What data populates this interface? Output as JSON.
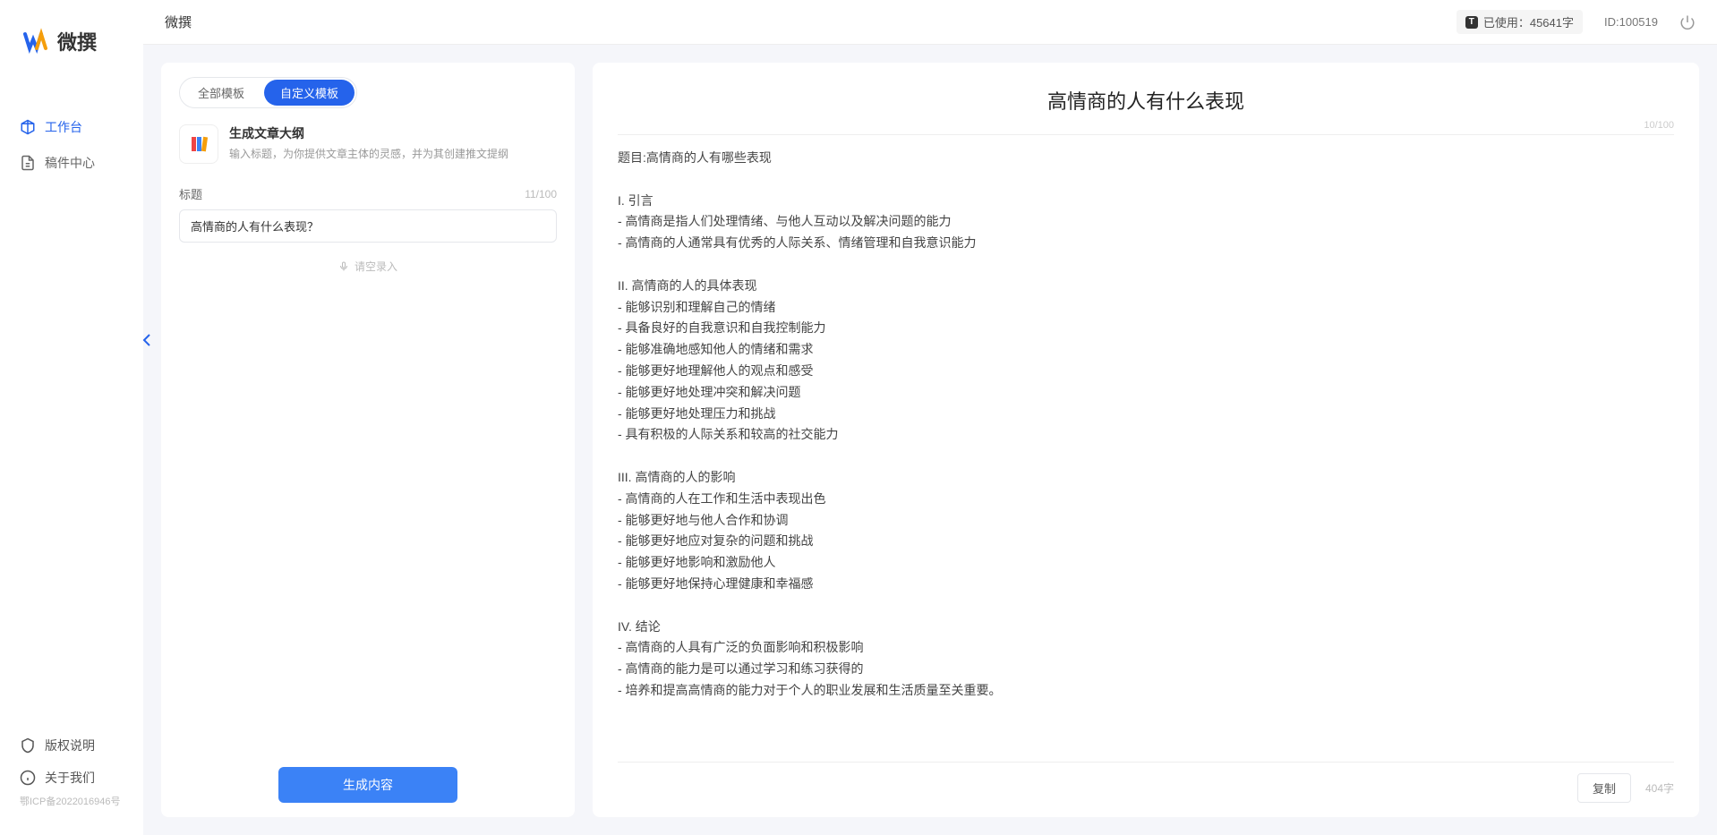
{
  "brand": {
    "name": "微撰"
  },
  "nav": {
    "workbench": "工作台",
    "drafts": "稿件中心"
  },
  "footer": {
    "copyright": "版权说明",
    "about": "关于我们",
    "icp": "鄂ICP备2022016946号"
  },
  "topbar": {
    "title": "微撰",
    "usage_label": "已使用：45641字",
    "user_id": "ID:100519"
  },
  "tabs": {
    "all": "全部模板",
    "custom": "自定义模板"
  },
  "template": {
    "title": "生成文章大纲",
    "desc": "输入标题，为你提供文章主体的灵感，并为其创建推文提纲"
  },
  "form": {
    "title_label": "标题",
    "title_count": "11/100",
    "title_value": "高情商的人有什么表现？",
    "voice_record": "请空录入",
    "generate": "生成内容"
  },
  "output": {
    "title": "高情商的人有什么表现",
    "title_count": "10/100",
    "body": "题目:高情商的人有哪些表现\n\nI. 引言\n- 高情商是指人们处理情绪、与他人互动以及解决问题的能力\n- 高情商的人通常具有优秀的人际关系、情绪管理和自我意识能力\n\nII. 高情商的人的具体表现\n- 能够识别和理解自己的情绪\n- 具备良好的自我意识和自我控制能力\n- 能够准确地感知他人的情绪和需求\n- 能够更好地理解他人的观点和感受\n- 能够更好地处理冲突和解决问题\n- 能够更好地处理压力和挑战\n- 具有积极的人际关系和较高的社交能力\n\nIII. 高情商的人的影响\n- 高情商的人在工作和生活中表现出色\n- 能够更好地与他人合作和协调\n- 能够更好地应对复杂的问题和挑战\n- 能够更好地影响和激励他人\n- 能够更好地保持心理健康和幸福感\n\nIV. 结论\n- 高情商的人具有广泛的负面影响和积极影响\n- 高情商的能力是可以通过学习和练习获得的\n- 培养和提高高情商的能力对于个人的职业发展和生活质量至关重要。",
    "copy": "复制",
    "char_count": "404字"
  }
}
